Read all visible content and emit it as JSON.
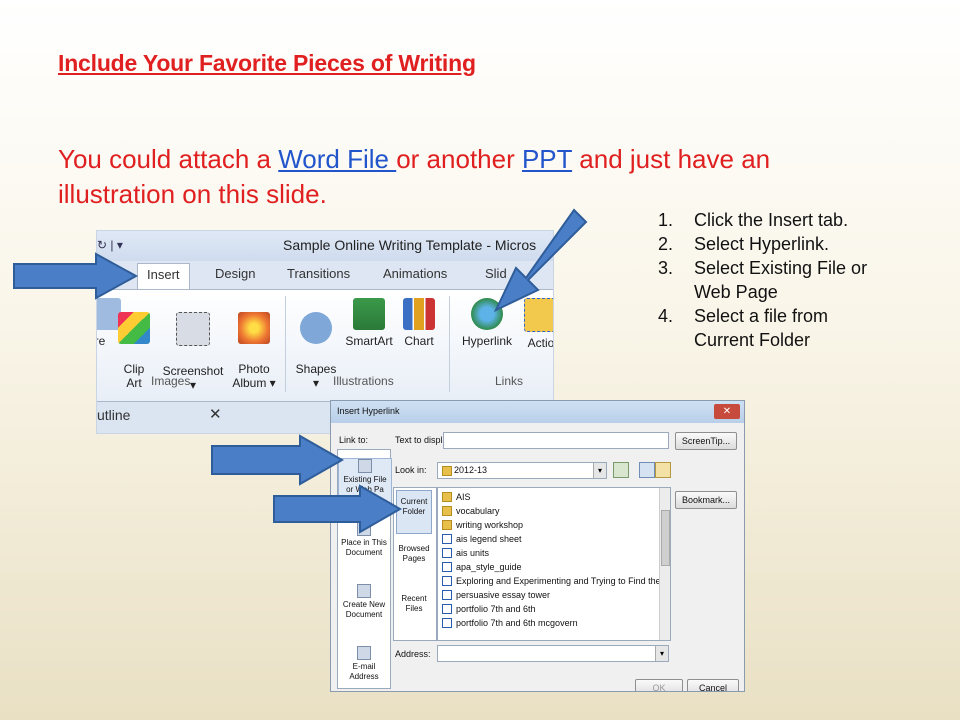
{
  "slide": {
    "title": "Include Your Favorite Pieces of Writing",
    "body_pre": "You could attach a ",
    "link_word": "Word File ",
    "body_mid": "or another ",
    "link_ppt": "PPT",
    "body_post": " and just have an illustration on this slide."
  },
  "steps": [
    {
      "num": "1.",
      "text": "Click the Insert tab."
    },
    {
      "num": "2.",
      "text": "Select Hyperlink."
    },
    {
      "num": "3.",
      "text": "Select Existing File or Web Page"
    },
    {
      "num": "4.",
      "text": "Select a file from Current Folder"
    }
  ],
  "ribbon": {
    "window_title": "Sample Online Writing Template  -  Micros",
    "tabs": [
      "Insert",
      "Design",
      "Transitions",
      "Animations",
      "Slid"
    ],
    "buttons": [
      {
        "label": "re",
        "icon": "picture-icon"
      },
      {
        "label": "Clip\nArt",
        "icon": "clip-art-icon"
      },
      {
        "label": "Screenshot\n▾",
        "icon": "screenshot-icon"
      },
      {
        "label": "Photo\nAlbum ▾",
        "icon": "photo-album-icon"
      },
      {
        "label": "Shapes\n▾",
        "icon": "shapes-icon"
      },
      {
        "label": "SmartArt",
        "icon": "smartart-icon"
      },
      {
        "label": "Chart",
        "icon": "chart-icon"
      },
      {
        "label": "Hyperlink",
        "icon": "hyperlink-icon"
      },
      {
        "label": "Actio",
        "icon": "action-icon"
      }
    ],
    "groups": [
      "Images",
      "Illustrations",
      "Links"
    ],
    "outline_label": "utline",
    "outline_close": "✕"
  },
  "dialog": {
    "title": "Insert Hyperlink",
    "close": "✕",
    "link_to": "Link to:",
    "text_to_display": "Text to display:",
    "screentip": "ScreenTip...",
    "look_in": "Look in:",
    "look_in_value": "2012-13",
    "bookmark": "Bookmark...",
    "address": "Address:",
    "ok": "OK",
    "cancel": "Cancel",
    "link_bar": [
      {
        "label": "Existing File or Web Pa",
        "icon": "existing-file-icon",
        "selected": true
      },
      {
        "label": "Place in This Document",
        "icon": "place-in-document-icon",
        "selected": false
      },
      {
        "label": "Create New Document",
        "icon": "new-document-icon",
        "selected": false
      },
      {
        "label": "E-mail Address",
        "icon": "email-icon",
        "selected": false
      }
    ],
    "side_tabs": [
      {
        "label": "Current Folder",
        "selected": true
      },
      {
        "label": "Browsed Pages",
        "selected": false
      },
      {
        "label": "Recent Files",
        "selected": false
      }
    ],
    "files": [
      {
        "name": "AIS",
        "type": "folder"
      },
      {
        "name": "vocabulary",
        "type": "folder"
      },
      {
        "name": "writing workshop",
        "type": "folder"
      },
      {
        "name": "ais legend sheet",
        "type": "doc"
      },
      {
        "name": "ais units",
        "type": "doc"
      },
      {
        "name": "apa_style_guide",
        "type": "doc"
      },
      {
        "name": "Exploring and Experimenting and Trying to Find the Right M",
        "type": "doc"
      },
      {
        "name": "persuasive essay tower",
        "type": "doc"
      },
      {
        "name": "portfolio 7th and 6th",
        "type": "doc"
      },
      {
        "name": "portfolio 7th and 6th mcgovern",
        "type": "doc"
      }
    ]
  },
  "colors": {
    "title_red": "#e02020",
    "link_blue": "#2255cc",
    "arrow_blue": "#4a7fc8"
  }
}
